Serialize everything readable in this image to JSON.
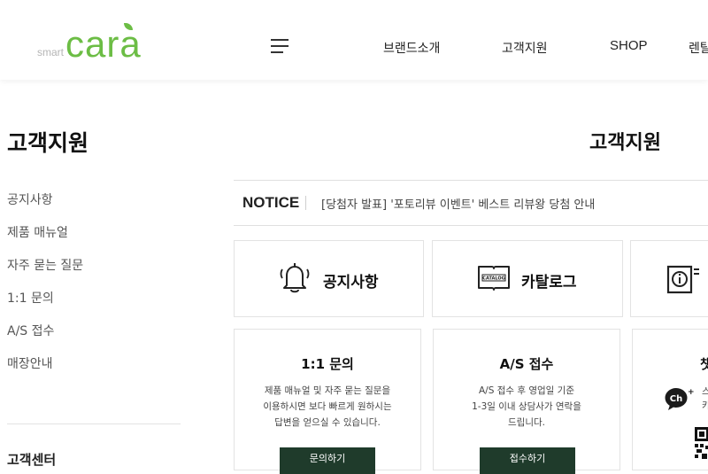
{
  "header": {
    "logo": {
      "prefix": "smart",
      "name": "cara"
    },
    "menu_icon": "hamburger-menu-icon",
    "nav": [
      "브랜드소개",
      "고객지원",
      "SHOP",
      "렌탈"
    ]
  },
  "sidebar": {
    "title": "고객지원",
    "items": [
      "공지사항",
      "제품 매뉴얼",
      "자주 묻는 질문",
      "1:1 문의",
      "A/S 접수",
      "매장안내"
    ],
    "bottom_title": "고객센터"
  },
  "main": {
    "title": "고객지원",
    "notice": {
      "label": "NOTICE",
      "text": "[당첨자 발표] '포토리뷰 이벤트' 베스트 리뷰왕 당첨 안내"
    },
    "quick_cards": [
      {
        "label": "공지사항",
        "icon": "bell-icon"
      },
      {
        "label": "카탈로그",
        "icon": "catalog-book-icon",
        "icon_text": "CATALOG"
      },
      {
        "label": "",
        "icon": "info-manual-icon"
      }
    ],
    "cards": [
      {
        "title": "1:1 문의",
        "desc": [
          "제품 매뉴얼 및 자주 묻는 질문을",
          "이용하시면 보다 빠르게 원하시는",
          "답변을 얻으실 수 있습니다."
        ],
        "button": "문의하기"
      },
      {
        "title": "A/S 접수",
        "desc": [
          "A/S 접수 후 영업일 기준",
          "1-3일 이내 상담사가 연락을",
          "드립니다."
        ],
        "button": "접수하기"
      },
      {
        "title": "챗",
        "desc": [
          "스",
          "카"
        ],
        "button": "",
        "icon": "kakao-channel-icon",
        "icon_text": "Ch",
        "qr": "qr-code-icon"
      }
    ]
  },
  "colors": {
    "brand_green": "#6cbd45",
    "button_dark": "#1f3b2b",
    "border": "#e3e3e3"
  }
}
